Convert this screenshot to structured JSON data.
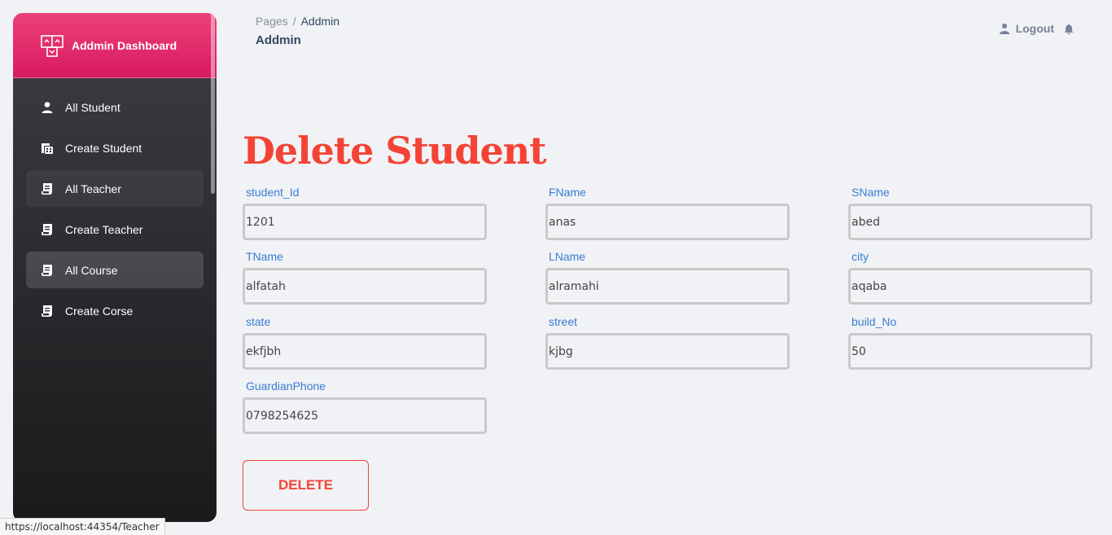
{
  "sidebar": {
    "brand": "Addmin Dashboard",
    "items": [
      {
        "label": "All Student",
        "icon": "person-icon"
      },
      {
        "label": "Create Student",
        "icon": "table-icon"
      },
      {
        "label": "All Teacher",
        "icon": "receipt-icon"
      },
      {
        "label": "Create Teacher",
        "icon": "receipt-icon"
      },
      {
        "label": "All Course",
        "icon": "receipt-icon"
      },
      {
        "label": "Create Corse",
        "icon": "receipt-icon"
      }
    ]
  },
  "breadcrumb": {
    "root": "Pages",
    "separator": "/",
    "current": "Addmin"
  },
  "page_title": "Addmin",
  "topbar": {
    "logout_label": "Logout"
  },
  "form": {
    "heading": "Delete Student",
    "fields": {
      "student_id": {
        "label": "student_Id",
        "value": "1201"
      },
      "fname": {
        "label": "FName",
        "value": "anas"
      },
      "sname": {
        "label": "SName",
        "value": "abed"
      },
      "tname": {
        "label": "TName",
        "value": "alfatah"
      },
      "lname": {
        "label": "LName",
        "value": "alramahi"
      },
      "city": {
        "label": "city",
        "value": "aqaba"
      },
      "state": {
        "label": "state",
        "value": "ekfjbh"
      },
      "street": {
        "label": "street",
        "value": "kjbg"
      },
      "build_no": {
        "label": "build_No",
        "value": "50"
      },
      "guardian_phone": {
        "label": "GuardianPhone",
        "value": "0798254625"
      }
    },
    "delete_label": "DELETE"
  },
  "status_bar": {
    "url": "https://localhost:44354/Teacher"
  },
  "colors": {
    "accent": "#e91e63",
    "danger": "#f44335",
    "label_blue": "#3a7bd5"
  }
}
